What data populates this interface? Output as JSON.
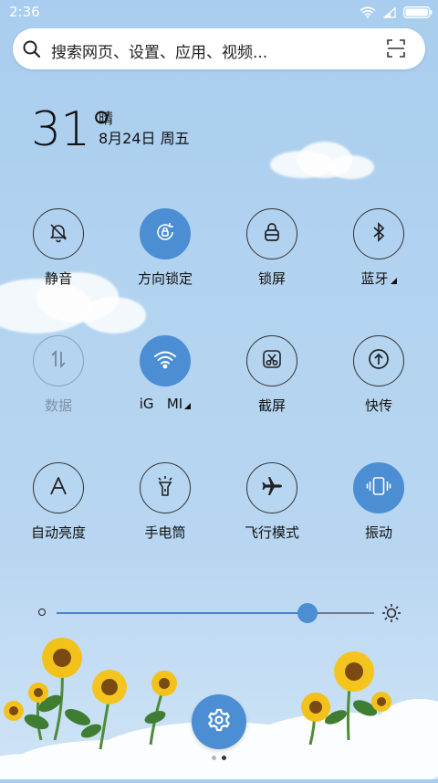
{
  "status_bar": {
    "time": "2:36",
    "icons": [
      "wifi-icon",
      "signal-icon",
      "battery-icon"
    ]
  },
  "search": {
    "placeholder": "搜索网页、设置、应用、视频...",
    "icon": "search-icon",
    "scan_icon": "scan-icon"
  },
  "weather": {
    "temperature": "31°",
    "condition": "晴",
    "date": "8月24日 周五"
  },
  "toggles": [
    {
      "label": "静音",
      "icon": "bell-off-icon",
      "state": "off"
    },
    {
      "label": "方向锁定",
      "icon": "rotation-lock-icon",
      "state": "on"
    },
    {
      "label": "锁屏",
      "icon": "lock-icon",
      "state": "off"
    },
    {
      "label": "蓝牙",
      "icon": "bluetooth-icon",
      "state": "off",
      "has_more": true
    },
    {
      "label": "数据",
      "icon": "data-arrows-icon",
      "state": "disabled"
    },
    {
      "label": "iG   MI",
      "icon": "wifi-icon",
      "state": "on",
      "has_more": true
    },
    {
      "label": "截屏",
      "icon": "screenshot-icon",
      "state": "off"
    },
    {
      "label": "快传",
      "icon": "share-upload-icon",
      "state": "off"
    },
    {
      "label": "自动亮度",
      "icon": "auto-brightness-icon",
      "state": "off"
    },
    {
      "label": "手电筒",
      "icon": "flashlight-icon",
      "state": "off"
    },
    {
      "label": "飞行模式",
      "icon": "airplane-icon",
      "state": "off"
    },
    {
      "label": "振动",
      "icon": "vibrate-icon",
      "state": "on"
    }
  ],
  "brightness": {
    "level": 0.79,
    "low_icon": "brightness-low-icon",
    "high_icon": "brightness-high-icon"
  },
  "page_indicator": {
    "pages": 2,
    "current": 2
  },
  "colors": {
    "accent": "#4c8ed3",
    "background": "#b2d3f0"
  }
}
